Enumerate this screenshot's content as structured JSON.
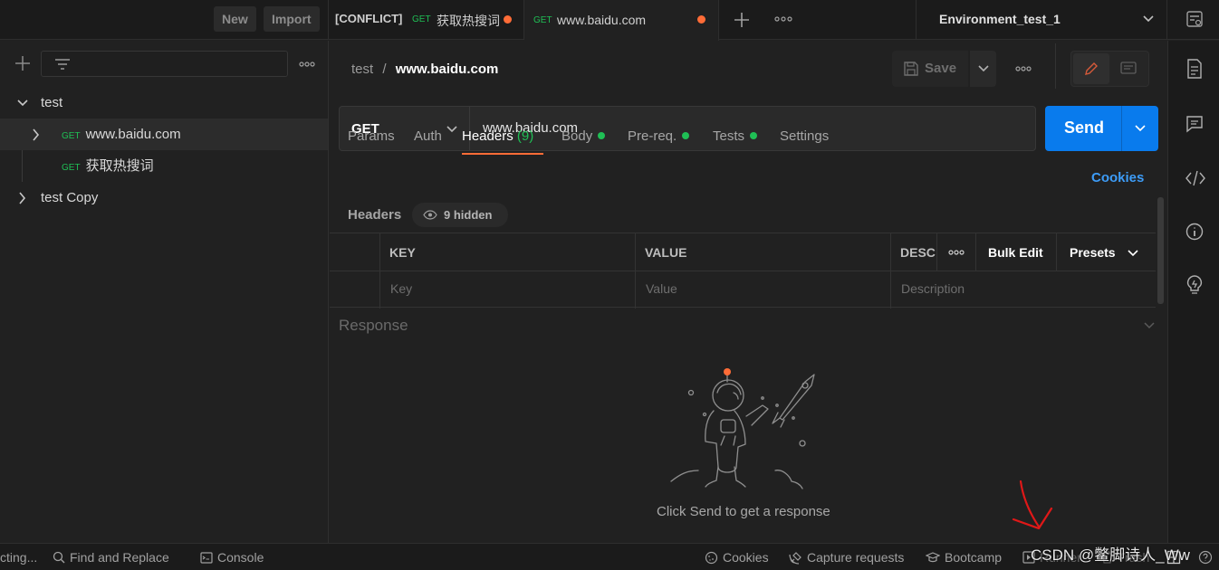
{
  "topbar": {
    "new_label": "New",
    "import_label": "Import",
    "tabs": [
      {
        "prefix": "[CONFLICT]",
        "method": "GET",
        "title": "获取热搜词"
      },
      {
        "method": "GET",
        "title": "www.baidu.com"
      }
    ],
    "environment": "Environment_test_1"
  },
  "sidebar": {
    "items": [
      {
        "label": "test"
      },
      {
        "method": "GET",
        "label": "www.baidu.com"
      },
      {
        "method": "GET",
        "label": "获取热搜词"
      },
      {
        "label": "test Copy"
      }
    ]
  },
  "request": {
    "breadcrumb_parent": "test",
    "breadcrumb_sep": "/",
    "breadcrumb_current": "www.baidu.com",
    "save_label": "Save",
    "method": "GET",
    "url": "www.baidu.com",
    "send_label": "Send",
    "tabs": {
      "params": "Params",
      "auth": "Auth",
      "headers": "Headers",
      "headers_count": "(9)",
      "body": "Body",
      "prereq": "Pre-req.",
      "tests": "Tests",
      "settings": "Settings"
    },
    "cookies_label": "Cookies",
    "headers_label": "Headers",
    "hidden_label": "9 hidden",
    "table": {
      "key_header": "KEY",
      "value_header": "VALUE",
      "desc_header": "DESC",
      "bulk_edit": "Bulk Edit",
      "presets": "Presets",
      "key_placeholder": "Key",
      "value_placeholder": "Value",
      "desc_placeholder": "Description"
    }
  },
  "response": {
    "title": "Response",
    "empty_message": "Click Send to get a response"
  },
  "statusbar": {
    "connecting": "cting...",
    "find_replace": "Find and Replace",
    "console": "Console",
    "cookies": "Cookies",
    "capture": "Capture requests",
    "bootcamp": "Bootcamp",
    "runner": "Runner",
    "trash": "Trash",
    "watermark": "CSDN @鳖脚诗人_Ww"
  },
  "colors": {
    "accent_orange": "#ff6c37",
    "send_blue": "#097bed",
    "method_green": "#1fbf55",
    "link_blue": "#3d9cf7"
  }
}
